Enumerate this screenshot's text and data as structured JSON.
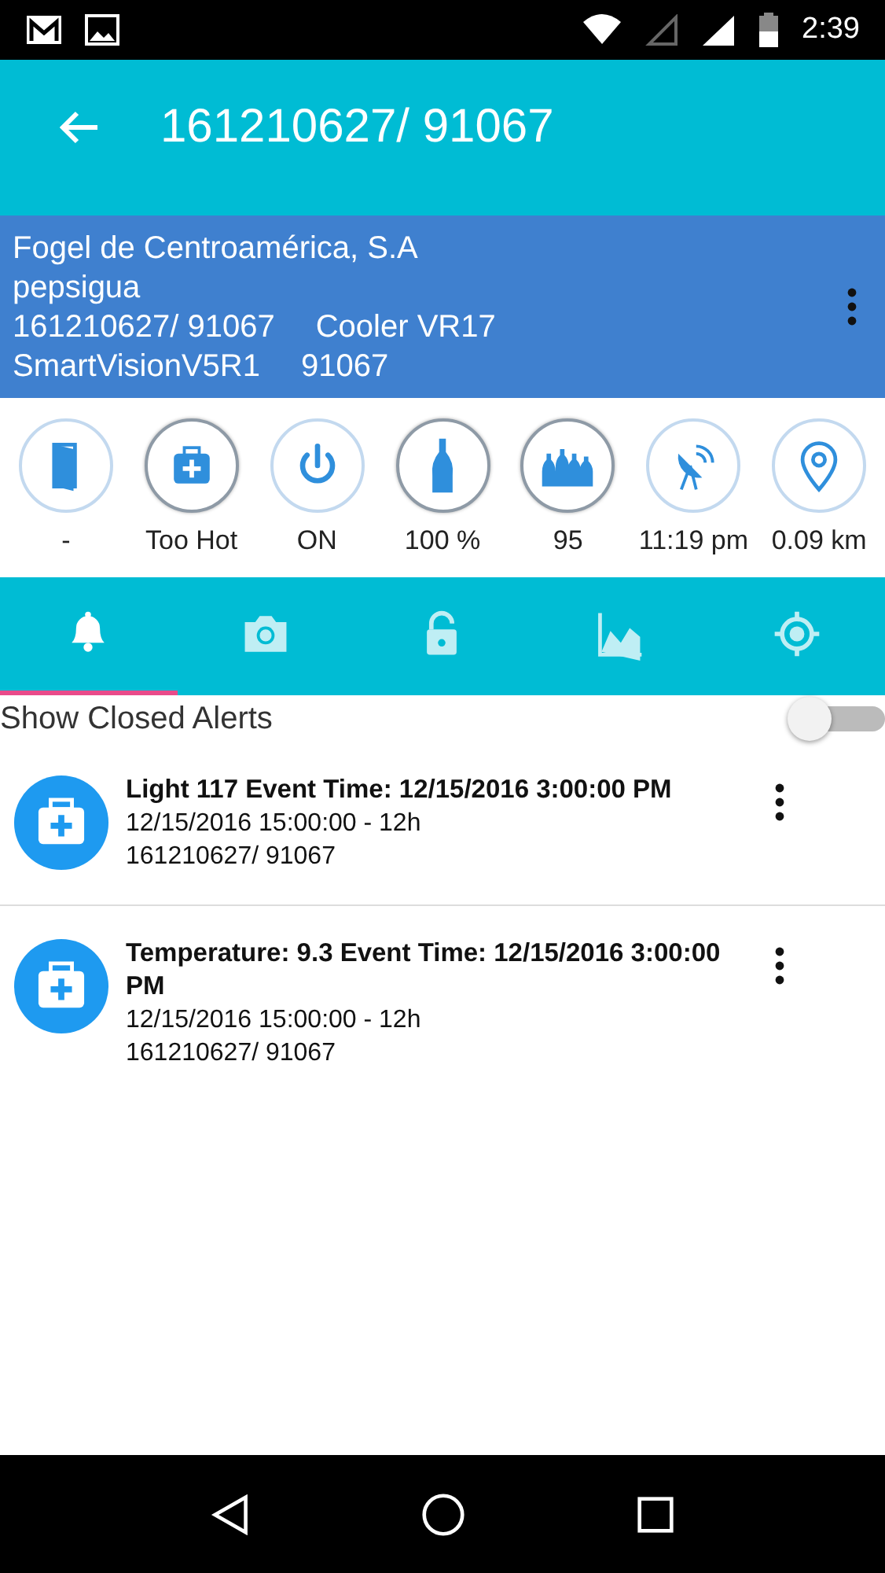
{
  "status_bar": {
    "time": "2:39"
  },
  "toolbar": {
    "title": "161210627/ 91067"
  },
  "info": {
    "lines": [
      [
        "Fogel de Centroamérica, S.A"
      ],
      [
        "pepsigua"
      ],
      [
        "161210627/ 91067",
        "Cooler VR17"
      ],
      [
        "SmartVisionV5R1",
        "91067"
      ]
    ]
  },
  "indicators": [
    {
      "kind": "door",
      "label": "-",
      "highlighted": false
    },
    {
      "kind": "medkit",
      "label": "Too Hot",
      "highlighted": true
    },
    {
      "kind": "power",
      "label": "ON",
      "highlighted": false
    },
    {
      "kind": "bottle",
      "label": "100 %",
      "highlighted": true
    },
    {
      "kind": "bottles",
      "label": "95",
      "highlighted": true
    },
    {
      "kind": "satellite",
      "label": "11:19 pm",
      "highlighted": false
    },
    {
      "kind": "pin",
      "label": "0.09 km",
      "highlighted": false
    }
  ],
  "tabs": [
    {
      "kind": "bell",
      "selected": true
    },
    {
      "kind": "camera",
      "selected": false
    },
    {
      "kind": "lock",
      "selected": false
    },
    {
      "kind": "chart",
      "selected": false
    },
    {
      "kind": "target",
      "selected": false
    }
  ],
  "show_closed": {
    "label": "Show Closed Alerts",
    "on": false
  },
  "alerts": [
    {
      "title": "Light 117 Event Time: 12/15/2016 3:00:00 PM",
      "time": "12/15/2016 15:00:00 - 12h",
      "device": "161210627/ 91067"
    },
    {
      "title": "Temperature: 9.3 Event Time: 12/15/2016 3:00:00 PM",
      "time": "12/15/2016 15:00:00 - 12h",
      "device": "161210627/ 91067"
    }
  ]
}
